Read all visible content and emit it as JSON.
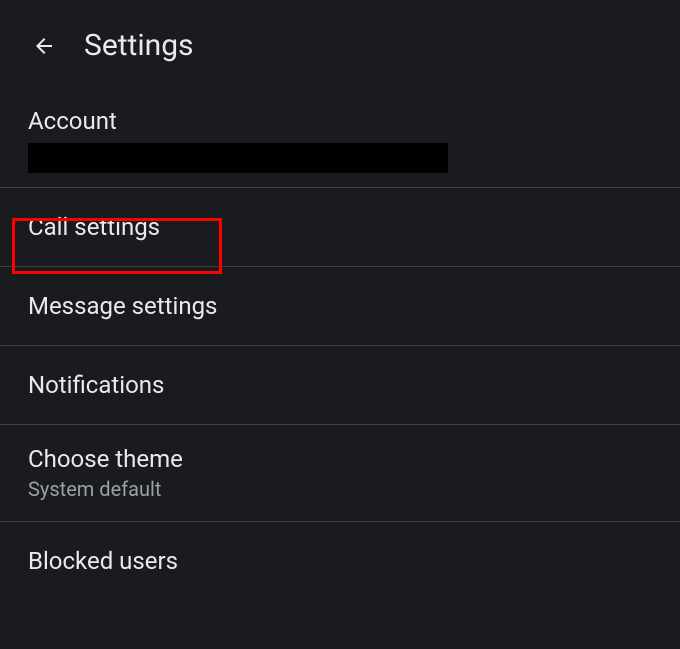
{
  "header": {
    "title": "Settings"
  },
  "account": {
    "label": "Account"
  },
  "items": [
    {
      "title": "Call settings",
      "subtitle": null
    },
    {
      "title": "Message settings",
      "subtitle": null
    },
    {
      "title": "Notifications",
      "subtitle": null
    },
    {
      "title": "Choose theme",
      "subtitle": "System default"
    },
    {
      "title": "Blocked users",
      "subtitle": null
    }
  ]
}
